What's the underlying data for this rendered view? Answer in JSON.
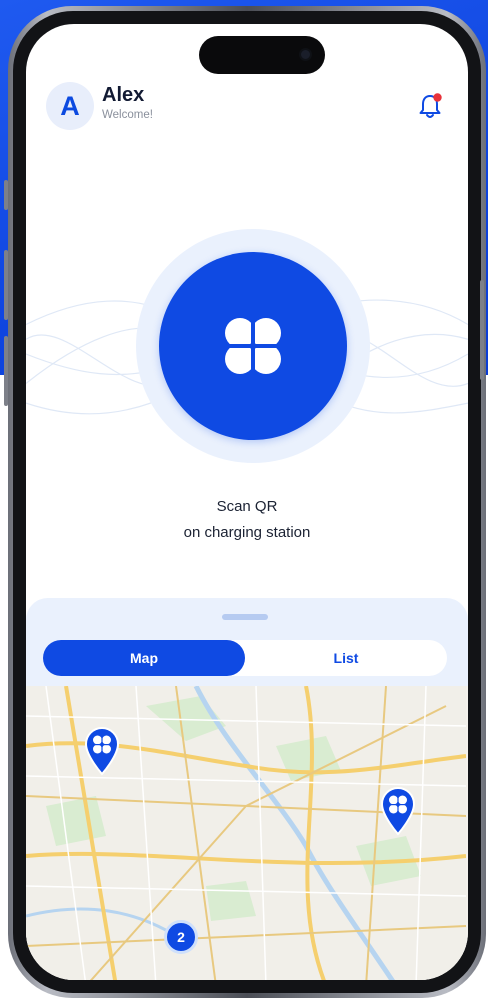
{
  "user": {
    "initial": "A",
    "name": "Alex",
    "greeting": "Welcome!"
  },
  "notifications": {
    "icon": "bell-icon",
    "has_unread": true
  },
  "scan": {
    "line1": "Scan QR",
    "line2": "on charging station"
  },
  "view_toggle": {
    "options": [
      {
        "label": "Map",
        "active": true
      },
      {
        "label": "List",
        "active": false
      }
    ]
  },
  "map": {
    "cluster_count": "2",
    "pins": [
      "charging-station-pin",
      "charging-station-pin"
    ]
  },
  "colors": {
    "brand": "#0f4ae3",
    "light": "#eaf1fd",
    "notification_dot": "#e8323a",
    "background_blue": "#1f5af0"
  }
}
